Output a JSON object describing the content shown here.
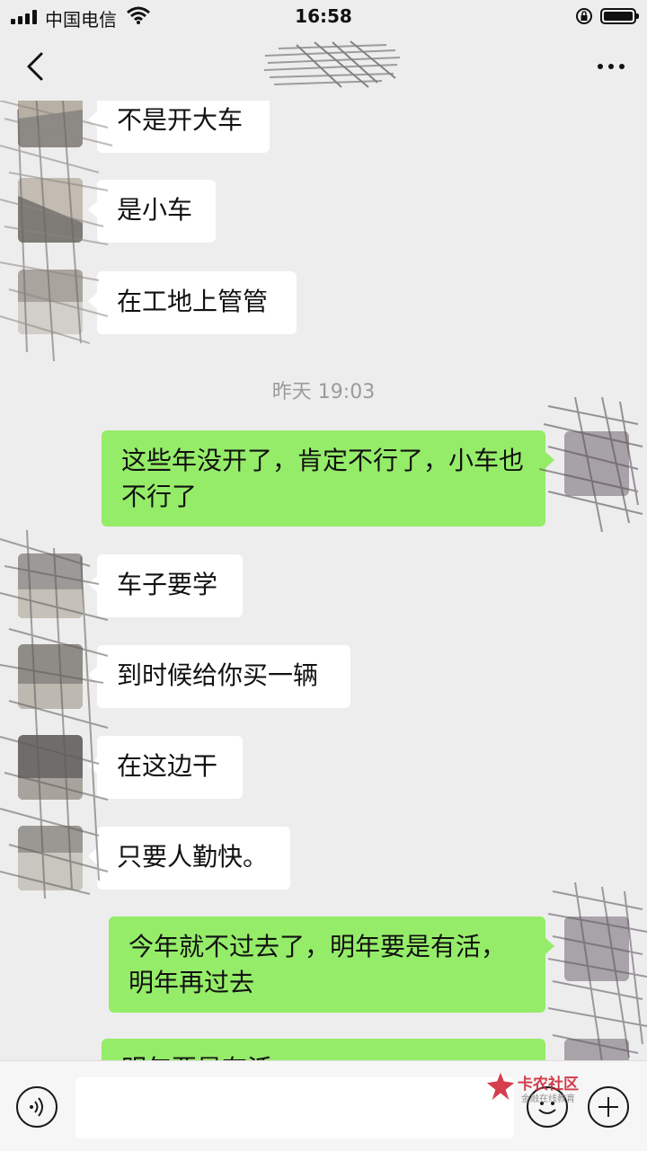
{
  "status_bar": {
    "carrier": "中国电信",
    "time": "16:58"
  },
  "messages": [
    {
      "dir": "in",
      "text": "不是开大车"
    },
    {
      "dir": "in",
      "text": "是小车"
    },
    {
      "dir": "in",
      "text": "在工地上管管"
    },
    {
      "timestamp": "昨天 19:03"
    },
    {
      "dir": "out",
      "text": "这些年没开了，肯定不行了，小车也不行了"
    },
    {
      "dir": "in",
      "text": "车子要学"
    },
    {
      "dir": "in",
      "text": "到时候给你买一辆"
    },
    {
      "dir": "in",
      "text": "在这边干"
    },
    {
      "dir": "in",
      "text": "只要人勤快。"
    },
    {
      "dir": "out",
      "text": "今年就不过去了，明年要是有活，明年再过去"
    },
    {
      "dir": "out",
      "text": "明年要是有活，…"
    }
  ],
  "watermark": {
    "brand": "卡农社区",
    "sub": "金融在线教育"
  },
  "icons": [
    "back-icon",
    "more-icon",
    "voice-icon",
    "emoji-icon",
    "plus-icon"
  ]
}
